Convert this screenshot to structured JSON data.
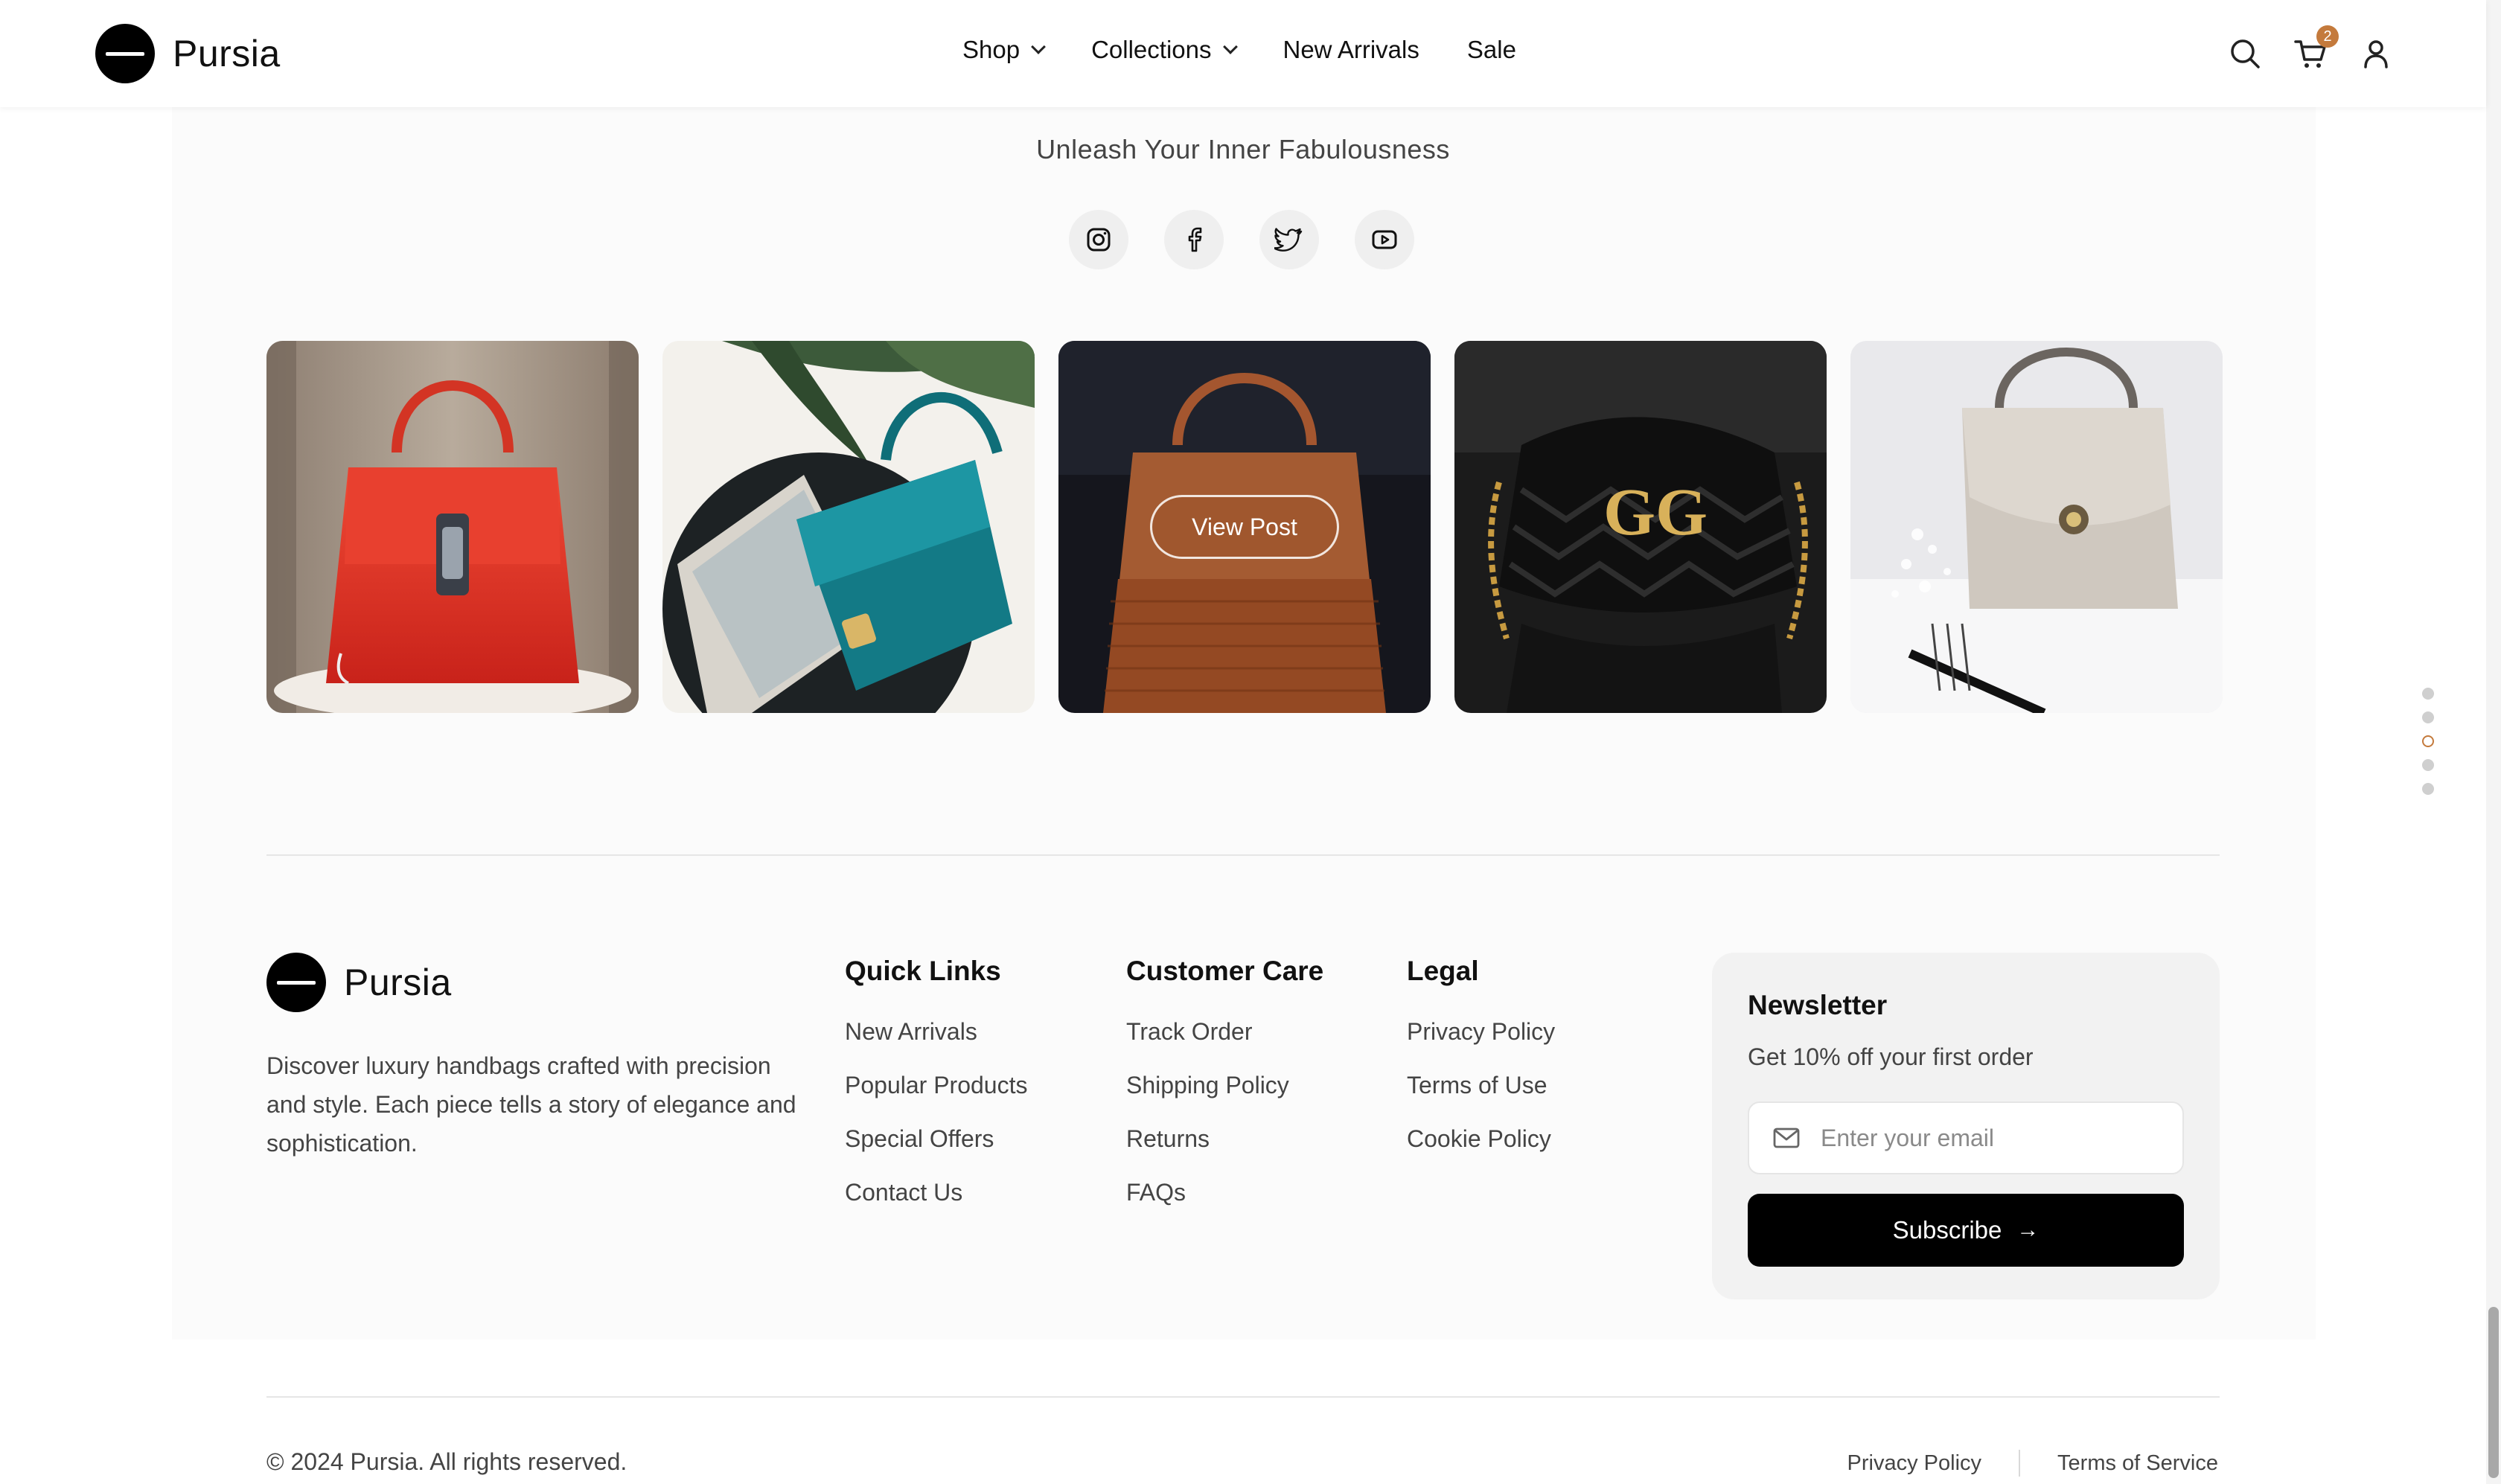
{
  "brand": {
    "name": "Pursia"
  },
  "nav": {
    "items": [
      {
        "label": "Shop",
        "has_dropdown": true
      },
      {
        "label": "Collections",
        "has_dropdown": true
      },
      {
        "label": "New Arrivals",
        "has_dropdown": false
      },
      {
        "label": "Sale",
        "has_dropdown": false
      }
    ]
  },
  "header_icons": {
    "search": "search-icon",
    "cart": "cart-icon",
    "account": "user-icon",
    "cart_count": "2"
  },
  "social": {
    "tagline": "Unleash Your Inner Fabulousness",
    "icons": [
      "instagram-icon",
      "facebook-icon",
      "twitter-icon",
      "youtube-icon"
    ]
  },
  "gallery": {
    "items": [
      {
        "name": "red-handbag"
      },
      {
        "name": "teal-handbag"
      },
      {
        "name": "woven-tan-handbag",
        "hover_label": "View Post"
      },
      {
        "name": "black-quilted-bag"
      },
      {
        "name": "beige-handbag"
      }
    ],
    "carousel_dots": 5,
    "active_dot": 2
  },
  "footer": {
    "brand": "Pursia",
    "description": "Discover luxury handbags crafted with precision and style. Each piece tells a story of elegance and sophistication.",
    "columns": [
      {
        "title": "Quick Links",
        "links": [
          "New Arrivals",
          "Popular Products",
          "Special Offers",
          "Contact Us"
        ]
      },
      {
        "title": "Customer Care",
        "links": [
          "Track Order",
          "Shipping Policy",
          "Returns",
          "FAQs"
        ]
      },
      {
        "title": "Legal",
        "links": [
          "Privacy Policy",
          "Terms of Use",
          "Cookie Policy"
        ]
      }
    ],
    "newsletter": {
      "title": "Newsletter",
      "subtitle": "Get 10% off your first order",
      "placeholder": "Enter your email",
      "button": "Subscribe"
    },
    "copyright": "© 2024 Pursia. All rights reserved.",
    "bottom_links": [
      "Privacy Policy",
      "Terms of Service"
    ]
  },
  "colors": {
    "accent": "#c47a3c",
    "button": "#000000",
    "panel": "#fbfbfb"
  }
}
